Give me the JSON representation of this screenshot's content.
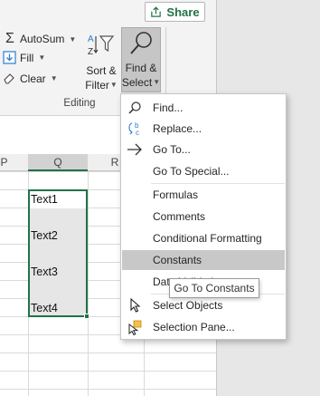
{
  "ribbon": {
    "share_label": "Share",
    "autosum_label": "AutoSum",
    "fill_label": "Fill",
    "clear_label": "Clear",
    "sort_line1": "Sort &",
    "sort_line2": "Filter",
    "find_line1": "Find &",
    "find_line2": "Select",
    "group_label": "Editing"
  },
  "grid": {
    "columns": [
      {
        "label": "P"
      },
      {
        "label": "Q"
      },
      {
        "label": "R"
      }
    ],
    "cells": [
      "Text1",
      "Text2",
      "Text3",
      "Text4"
    ]
  },
  "menu": {
    "items": [
      {
        "label": "Find...",
        "icon": "magnifier-icon"
      },
      {
        "label": "Replace...",
        "icon": "replace-icon"
      },
      {
        "label": "Go To...",
        "icon": "arrow-right-icon"
      },
      {
        "label": "Go To Special..."
      },
      {
        "label": "Formulas"
      },
      {
        "label": "Comments"
      },
      {
        "label": "Conditional Formatting"
      },
      {
        "label": "Constants",
        "highlighted": true
      },
      {
        "label": "Data Validation"
      },
      {
        "label": "Select Objects",
        "icon": "pointer-icon"
      },
      {
        "label": "Selection Pane...",
        "icon": "selection-pane-icon"
      }
    ]
  },
  "tooltip": "Go To Constants",
  "colors": {
    "excel_green": "#217346",
    "highlight": "#c8c8c8"
  }
}
